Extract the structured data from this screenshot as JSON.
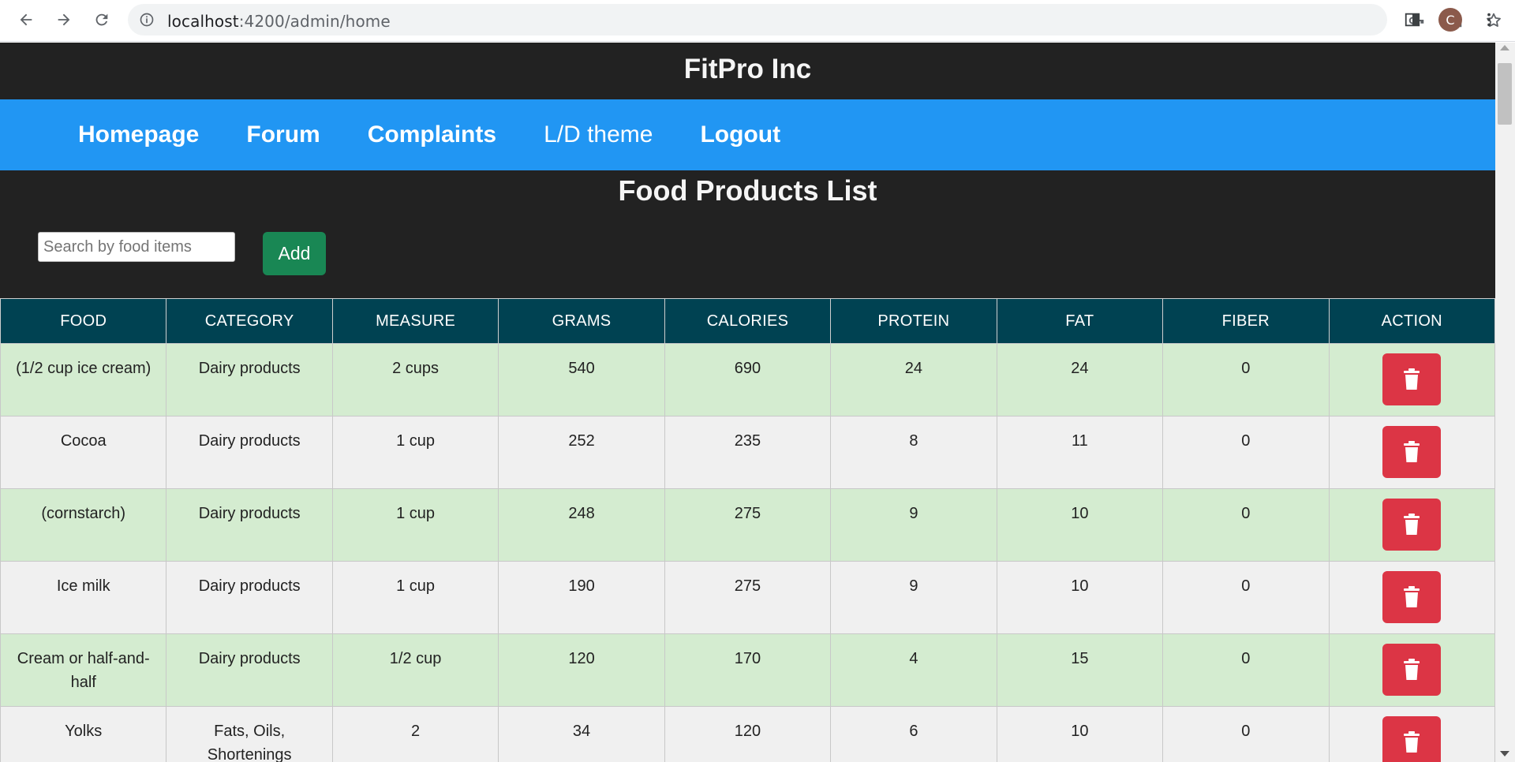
{
  "browser": {
    "url_host": "localhost",
    "url_path": ":4200/admin/home",
    "profile_initial": "C"
  },
  "app": {
    "title": "FitPro Inc"
  },
  "nav": {
    "items": [
      "Homepage",
      "Forum",
      "Complaints",
      "L/D theme",
      "Logout"
    ]
  },
  "page": {
    "heading": "Food Products List",
    "search_placeholder": "Search by food items",
    "add_label": "Add"
  },
  "table": {
    "headers": [
      "FOOD",
      "CATEGORY",
      "MEASURE",
      "GRAMS",
      "CALORIES",
      "PROTEIN",
      "FAT",
      "FIBER",
      "ACTION"
    ],
    "rows": [
      [
        "(1/2 cup ice cream)",
        "Dairy products",
        "2 cups",
        "540",
        "690",
        "24",
        "24",
        "0"
      ],
      [
        "Cocoa",
        "Dairy products",
        "1 cup",
        "252",
        "235",
        "8",
        "11",
        "0"
      ],
      [
        "(cornstarch)",
        "Dairy products",
        "1 cup",
        "248",
        "275",
        "9",
        "10",
        "0"
      ],
      [
        "Ice milk",
        "Dairy products",
        "1 cup",
        "190",
        "275",
        "9",
        "10",
        "0"
      ],
      [
        "Cream or half-and-half",
        "Dairy products",
        "1/2 cup",
        "120",
        "170",
        "4",
        "15",
        "0"
      ],
      [
        "Yolks",
        "Fats, Oils, Shortenings",
        "2",
        "34",
        "120",
        "6",
        "10",
        "0"
      ]
    ]
  },
  "colors": {
    "header_bg": "#222222",
    "navbar_bg": "#2196f3",
    "table_header_bg": "#004252",
    "row_green": "#d4ecd0",
    "row_grey": "#f0f0f0",
    "add_button": "#198754",
    "delete_button": "#dc3545"
  },
  "icons": {
    "delete": "trash-icon"
  }
}
